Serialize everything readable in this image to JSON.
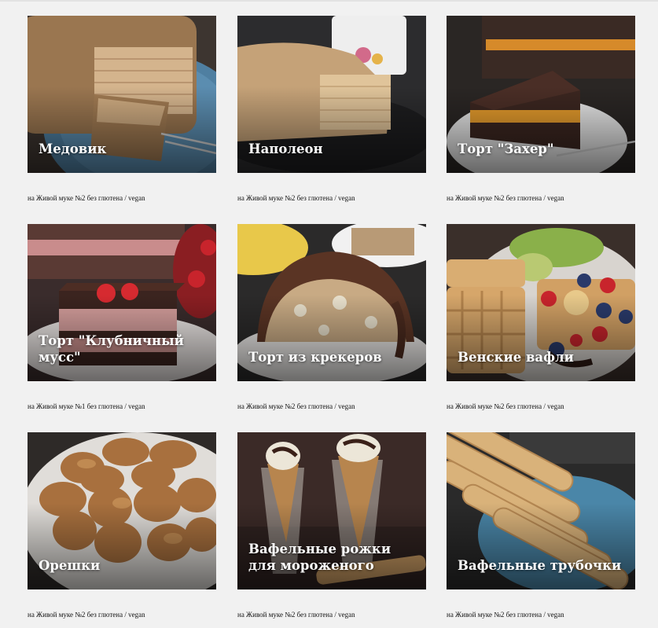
{
  "recipes": [
    {
      "title": "Медовик",
      "flour": "на Живой муке №2",
      "tag1": "без глютена",
      "sep": "/",
      "tag2": "vegan"
    },
    {
      "title": "Наполеон",
      "flour": "на Живой муке №2",
      "tag1": "без глютена",
      "sep": "/",
      "tag2": "vegan"
    },
    {
      "title": "Торт \"Захер\"",
      "flour": "на Живой муке №2",
      "tag1": "без глютена",
      "sep": "/",
      "tag2": "vegan"
    },
    {
      "title": "Торт \"Клубничный мусс\"",
      "flour": "на Живой муке №1",
      "tag1": "без глютена",
      "sep": "/",
      "tag2": "vegan"
    },
    {
      "title": "Торт из крекеров",
      "flour": "на Живой муке №2",
      "tag1": "без глютена",
      "sep": "/",
      "tag2": "vegan"
    },
    {
      "title": "Венские вафли",
      "flour": "на Живой муке №2",
      "tag1": "без глютена",
      "sep": "/",
      "tag2": "vegan"
    },
    {
      "title": "Орешки",
      "flour": "на Живой муке №2",
      "tag1": "без глютена",
      "sep": "/",
      "tag2": "vegan"
    },
    {
      "title": "Вафельные рожки для мороженого",
      "flour": "на Живой муке №2",
      "tag1": "без глютена",
      "sep": "/",
      "tag2": "vegan"
    },
    {
      "title": "Вафельные трубочки",
      "flour": "на Живой муке №2",
      "tag1": "без глютена",
      "sep": "/",
      "tag2": "vegan"
    }
  ],
  "colors": {
    "background": "#f1f1f1",
    "title_text": "#ffffff",
    "meta_text": "#111111"
  }
}
